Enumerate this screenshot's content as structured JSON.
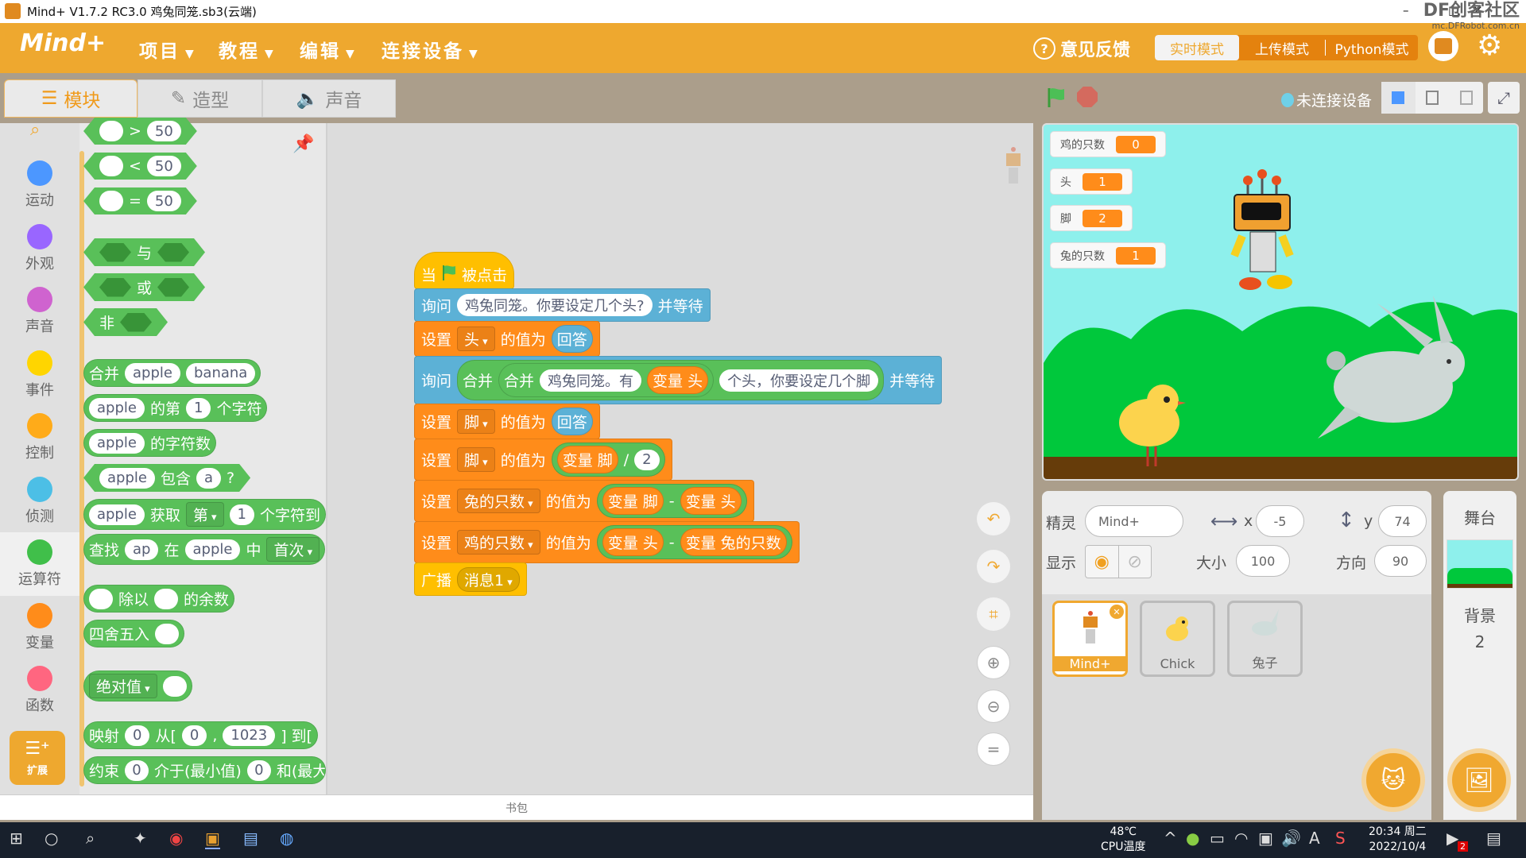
{
  "window": {
    "title": "Mind+ V1.7.2 RC3.0   鸡兔同笼.sb3(云端)",
    "minimize": "–",
    "maximize": "□",
    "close": "✕",
    "watermark": "DF创客社区",
    "watermark_url": "mc.DFRobot.com.cn"
  },
  "header": {
    "logo": "Mind+",
    "menus": [
      "项目",
      "教程",
      "编辑",
      "连接设备"
    ],
    "feedback": "意见反馈",
    "modes": [
      "实时模式",
      "上传模式",
      "Python模式"
    ],
    "active_mode": "实时模式",
    "accent": "#EEA82F"
  },
  "tabs": [
    {
      "label": "模块",
      "active": true
    },
    {
      "label": "造型"
    },
    {
      "label": "声音"
    }
  ],
  "toolbar": {
    "connection_status": "未连接设备"
  },
  "categories": [
    {
      "label": "运动",
      "color": "#4C97FF"
    },
    {
      "label": "外观",
      "color": "#9966FF"
    },
    {
      "label": "声音",
      "color": "#CF63CF"
    },
    {
      "label": "事件",
      "color": "#FFD500"
    },
    {
      "label": "控制",
      "color": "#FFAB19"
    },
    {
      "label": "侦测",
      "color": "#4CBFE6"
    },
    {
      "label": "运算符",
      "color": "#40BF4A",
      "active": true
    },
    {
      "label": "变量",
      "color": "#FF8C1A"
    },
    {
      "label": "函数",
      "color": "#FF6680"
    }
  ],
  "extension_label": "扩展",
  "palette": [
    {
      "shape": "bool",
      "parts": [
        {
          "i": ""
        },
        {
          "t": ">"
        },
        {
          "i": "50"
        }
      ]
    },
    {
      "shape": "bool",
      "parts": [
        {
          "i": ""
        },
        {
          "t": "<"
        },
        {
          "i": "50"
        }
      ]
    },
    {
      "shape": "bool",
      "parts": [
        {
          "i": ""
        },
        {
          "t": "="
        },
        {
          "i": "50"
        }
      ]
    },
    {
      "shape": "bool",
      "parts": [
        {
          "h": 1
        },
        {
          "t": "与"
        },
        {
          "h": 1
        }
      ]
    },
    {
      "shape": "bool",
      "parts": [
        {
          "h": 1
        },
        {
          "t": "或"
        },
        {
          "h": 1
        }
      ]
    },
    {
      "shape": "bool",
      "parts": [
        {
          "t": "非"
        },
        {
          "h": 1
        }
      ]
    },
    {
      "shape": "rep",
      "parts": [
        {
          "t": "合并"
        },
        {
          "i": "apple"
        },
        {
          "i": "banana"
        }
      ]
    },
    {
      "shape": "rep",
      "parts": [
        {
          "i": "apple"
        },
        {
          "t": "的第"
        },
        {
          "i": "1"
        },
        {
          "t": "个字符"
        }
      ]
    },
    {
      "shape": "rep",
      "parts": [
        {
          "i": "apple"
        },
        {
          "t": "的字符数"
        }
      ]
    },
    {
      "shape": "bool",
      "parts": [
        {
          "i": "apple"
        },
        {
          "t": "包含"
        },
        {
          "i": "a"
        },
        {
          "t": "?"
        }
      ]
    },
    {
      "shape": "rep",
      "parts": [
        {
          "i": "apple"
        },
        {
          "t": "获取"
        },
        {
          "d": "第"
        },
        {
          "i": "1"
        },
        {
          "t": "个字符到"
        }
      ]
    },
    {
      "shape": "rep",
      "parts": [
        {
          "t": "查找"
        },
        {
          "i": "ap"
        },
        {
          "t": "在"
        },
        {
          "i": "apple"
        },
        {
          "t": "中"
        },
        {
          "d": "首次"
        }
      ]
    },
    {
      "shape": "rep",
      "parts": [
        {
          "i": ""
        },
        {
          "t": "除以"
        },
        {
          "i": ""
        },
        {
          "t": "的余数"
        }
      ]
    },
    {
      "shape": "rep",
      "parts": [
        {
          "t": "四舍五入"
        },
        {
          "i": ""
        }
      ]
    },
    {
      "shape": "rep",
      "parts": [
        {
          "d": "绝对值"
        },
        {
          "i": ""
        }
      ]
    },
    {
      "shape": "rep",
      "parts": [
        {
          "t": "映射"
        },
        {
          "i": "0"
        },
        {
          "t": "从["
        },
        {
          "i": "0"
        },
        {
          "t": ","
        },
        {
          "i": "1023"
        },
        {
          "t": "] 到["
        }
      ]
    },
    {
      "shape": "rep",
      "parts": [
        {
          "t": "约束"
        },
        {
          "i": "0"
        },
        {
          "t": "介于(最小值)"
        },
        {
          "i": "0"
        },
        {
          "t": "和(最大"
        }
      ]
    }
  ],
  "script": [
    {
      "shape": "hat",
      "color": "#FFBF00",
      "parts": [
        {
          "t": "当"
        },
        {
          "flag": 1
        },
        {
          "t": "被点击"
        }
      ]
    },
    {
      "shape": "stack",
      "color": "#5CB1D6",
      "parts": [
        {
          "t": "询问"
        },
        {
          "i": "鸡兔同笼。你要设定几个头?"
        },
        {
          "t": "并等待"
        }
      ]
    },
    {
      "shape": "stack",
      "color": "#FF8C1A",
      "parts": [
        {
          "t": "设置"
        },
        {
          "d": "头"
        },
        {
          "t": "的值为"
        },
        {
          "r": {
            "color": "#5CB1D6",
            "parts": [
              {
                "t": "回答"
              }
            ]
          }
        }
      ]
    },
    {
      "shape": "stack",
      "color": "#5CB1D6",
      "parts": [
        {
          "t": "询问"
        },
        {
          "r": {
            "color": "#59C059",
            "parts": [
              {
                "t": "合并"
              },
              {
                "r": {
                  "color": "#59C059",
                  "parts": [
                    {
                      "t": "合并"
                    },
                    {
                      "i": "鸡兔同笼。有"
                    },
                    {
                      "r": {
                        "color": "#FF8C1A",
                        "parts": [
                          {
                            "t": "变量 头"
                          }
                        ]
                      }
                    }
                  ]
                }
              },
              {
                "i": "个头，你要设定几个脚"
              }
            ]
          }
        },
        {
          "t": "并等待"
        }
      ]
    },
    {
      "shape": "stack",
      "color": "#FF8C1A",
      "parts": [
        {
          "t": "设置"
        },
        {
          "d": "脚"
        },
        {
          "t": "的值为"
        },
        {
          "r": {
            "color": "#5CB1D6",
            "parts": [
              {
                "t": "回答"
              }
            ]
          }
        }
      ]
    },
    {
      "shape": "stack",
      "color": "#FF8C1A",
      "parts": [
        {
          "t": "设置"
        },
        {
          "d": "脚"
        },
        {
          "t": "的值为"
        },
        {
          "r": {
            "color": "#59C059",
            "parts": [
              {
                "r": {
                  "color": "#FF8C1A",
                  "parts": [
                    {
                      "t": "变量 脚"
                    }
                  ]
                }
              },
              {
                "t": "/"
              },
              {
                "i": "2"
              }
            ]
          }
        }
      ]
    },
    {
      "shape": "stack",
      "color": "#FF8C1A",
      "parts": [
        {
          "t": "设置"
        },
        {
          "d": "兔的只数"
        },
        {
          "t": "的值为"
        },
        {
          "r": {
            "color": "#59C059",
            "parts": [
              {
                "r": {
                  "color": "#FF8C1A",
                  "parts": [
                    {
                      "t": "变量 脚"
                    }
                  ]
                }
              },
              {
                "t": "-"
              },
              {
                "r": {
                  "color": "#FF8C1A",
                  "parts": [
                    {
                      "t": "变量 头"
                    }
                  ]
                }
              }
            ]
          }
        }
      ]
    },
    {
      "shape": "stack",
      "color": "#FF8C1A",
      "parts": [
        {
          "t": "设置"
        },
        {
          "d": "鸡的只数"
        },
        {
          "t": "的值为"
        },
        {
          "r": {
            "color": "#59C059",
            "parts": [
              {
                "r": {
                  "color": "#FF8C1A",
                  "parts": [
                    {
                      "t": "变量 头"
                    }
                  ]
                }
              },
              {
                "t": "-"
              },
              {
                "r": {
                  "color": "#FF8C1A",
                  "parts": [
                    {
                      "t": "变量 兔的只数"
                    }
                  ]
                }
              }
            ]
          }
        }
      ]
    },
    {
      "shape": "stack",
      "color": "#FFBF00",
      "parts": [
        {
          "t": "广播"
        },
        {
          "d": "消息1"
        }
      ]
    }
  ],
  "backpack_label": "书包",
  "stage": {
    "monitors": [
      {
        "label": "鸡的只数",
        "value": "0"
      },
      {
        "label": "头",
        "value": "1"
      },
      {
        "label": "脚",
        "value": "2"
      },
      {
        "label": "兔的只数",
        "value": "1"
      }
    ]
  },
  "sprite_info": {
    "sprite_label": "精灵",
    "sprite_name": "Mind+",
    "x_label": "x",
    "x": "-5",
    "y_label": "y",
    "y": "74",
    "show_label": "显示",
    "size_label": "大小",
    "size": "100",
    "direction_label": "方向",
    "direction": "90"
  },
  "sprites": [
    {
      "name": "Mind+",
      "selected": true
    },
    {
      "name": "Chick"
    },
    {
      "name": "兔子"
    }
  ],
  "stage_panel": {
    "title": "舞台",
    "backdrops_label": "背景",
    "backdrop_count": "2"
  },
  "taskbar": {
    "cpu_temp": "48℃",
    "cpu_label": "CPU温度",
    "time": "20:34 周二",
    "date": "2022/10/4",
    "ime": "A",
    "notif_count": "2"
  }
}
